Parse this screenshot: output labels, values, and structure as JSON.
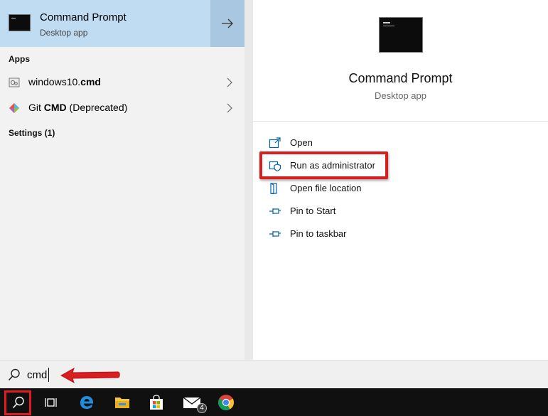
{
  "best_match": {
    "title": "Command Prompt",
    "subtitle": "Desktop app"
  },
  "sections": {
    "apps_label": "Apps",
    "settings_label": "Settings (1)"
  },
  "apps": [
    {
      "name_plain": "windows10.",
      "name_bold": "cmd",
      "name_suffix": "",
      "icon": "batch-file-icon"
    },
    {
      "name_plain": "Git ",
      "name_bold": "CMD",
      "name_suffix": " (Deprecated)",
      "icon": "git-icon"
    }
  ],
  "details": {
    "title": "Command Prompt",
    "subtitle": "Desktop app"
  },
  "actions": [
    {
      "label": "Open",
      "icon": "open-icon"
    },
    {
      "label": "Run as administrator",
      "icon": "shield-icon"
    },
    {
      "label": "Open file location",
      "icon": "file-location-icon"
    },
    {
      "label": "Pin to Start",
      "icon": "pin-icon"
    },
    {
      "label": "Pin to taskbar",
      "icon": "pin-icon"
    }
  ],
  "search": {
    "value": "cmd"
  },
  "taskbar": {
    "mail_badge": "4",
    "icons": [
      "search-icon",
      "task-view-icon",
      "edge-icon",
      "file-explorer-icon",
      "store-icon",
      "mail-icon",
      "chrome-icon"
    ]
  },
  "colors": {
    "selected_bg": "#bfdcf3",
    "arrow_bg": "#a9c7e0",
    "highlight_red": "#d81e1e",
    "taskbar_bg": "#101010",
    "accent_blue": "#0078d7"
  }
}
